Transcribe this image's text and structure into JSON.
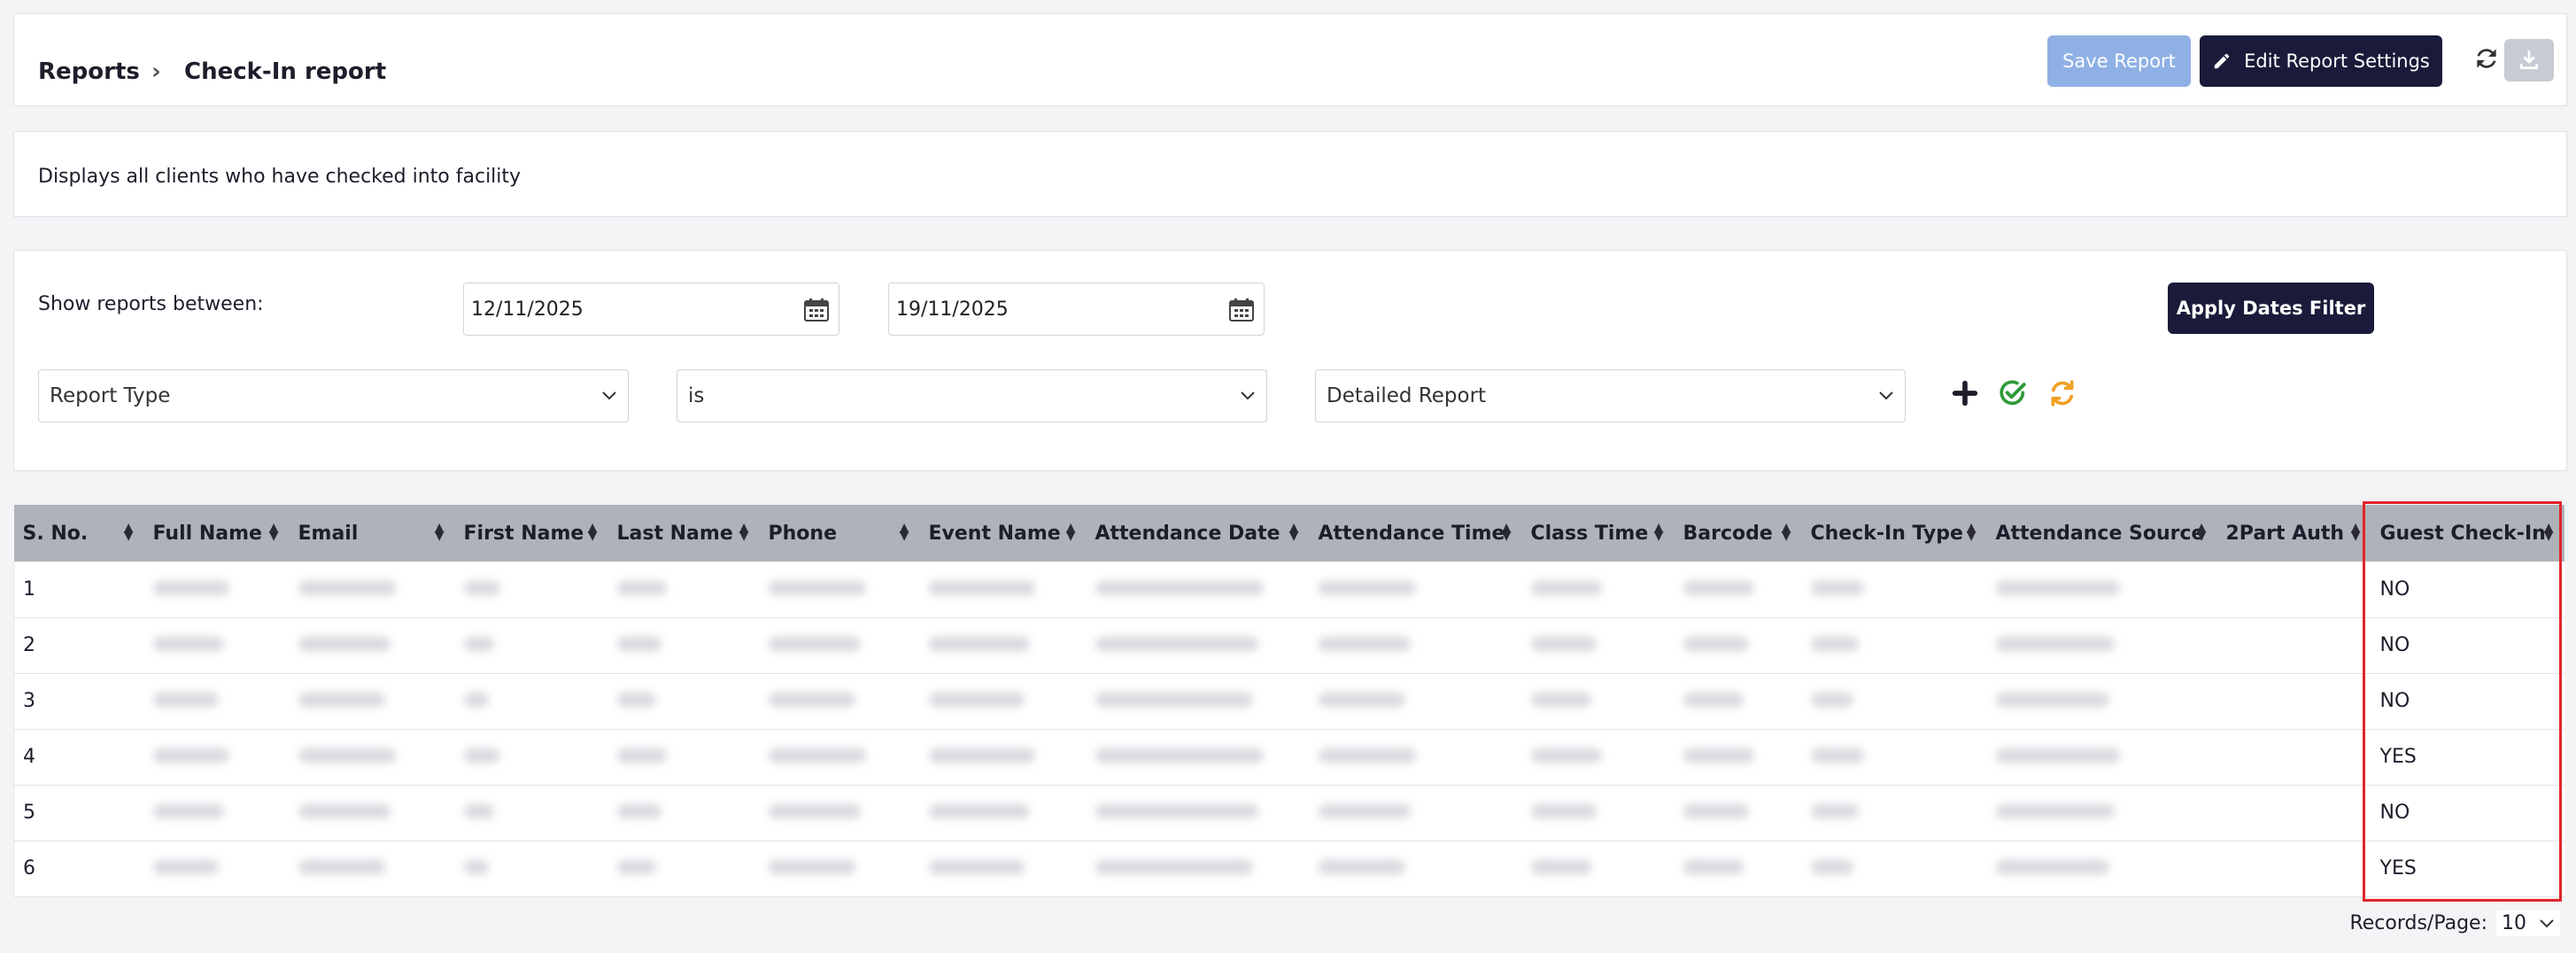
{
  "header": {
    "breadcrumb_root": "Reports",
    "breadcrumb_sep": "›",
    "title": "Check-In report",
    "save_label": "Save Report",
    "edit_label": "Edit Report Settings"
  },
  "description": "Displays all clients who have checked into facility",
  "filters": {
    "show_label": "Show reports between:",
    "date_from": "12/11/2025",
    "date_to": "19/11/2025",
    "apply_label": "Apply Dates Filter",
    "field": "Report Type",
    "operator": "is",
    "value": "Detailed Report"
  },
  "table": {
    "columns": [
      "S. No.",
      "Full Name",
      "Email",
      "First Name",
      "Last Name",
      "Phone",
      "Event Name",
      "Attendance Date",
      "Attendance Time",
      "Class Time",
      "Barcode",
      "Check-In Type",
      "Attendance Source",
      "2Part Auth",
      "Guest Check-In"
    ],
    "rows": [
      {
        "sno": "1",
        "guest": "NO"
      },
      {
        "sno": "2",
        "guest": "NO"
      },
      {
        "sno": "3",
        "guest": "NO"
      },
      {
        "sno": "4",
        "guest": "YES"
      },
      {
        "sno": "5",
        "guest": "NO"
      },
      {
        "sno": "6",
        "guest": "YES"
      }
    ]
  },
  "pager": {
    "label": "Records/Page:",
    "value": "10"
  },
  "colors": {
    "primary_dark": "#1a1a3a",
    "save_disabled": "#8fb0e4",
    "highlight": "#e0242b",
    "add_icon": "#1d1d2b",
    "apply_icon": "#2e9a3a",
    "reset_icon": "#f0a020"
  }
}
